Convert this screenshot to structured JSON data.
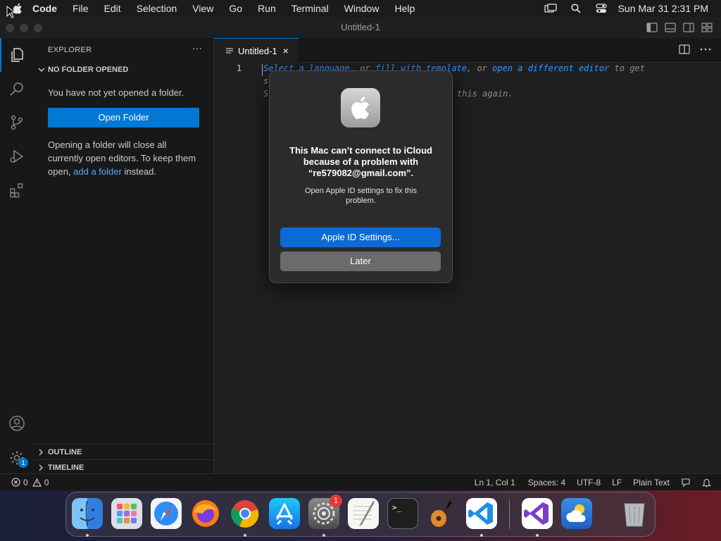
{
  "menubar": {
    "app": "Code",
    "items": [
      "File",
      "Edit",
      "Selection",
      "View",
      "Go",
      "Run",
      "Terminal",
      "Window",
      "Help"
    ],
    "clock": "Sun Mar 31  2:31 PM"
  },
  "window": {
    "title": "Untitled-1"
  },
  "sidebar": {
    "title": "EXPLORER",
    "more": "···",
    "section": "NO FOLDER OPENED",
    "no_folder_text": "You have not yet opened a folder.",
    "open_folder_label": "Open Folder",
    "info_part1": "Opening a folder will close all currently open editors. To keep them open,",
    "info_link": "add a folder",
    "info_part2": "instead.",
    "outline": "OUTLINE",
    "timeline": "TIMELINE",
    "settings_badge": "1"
  },
  "editor": {
    "tab_label": "Untitled-1",
    "tab_close": "×",
    "line_number": "1",
    "hint_pre": "Select a language",
    "hint_mid1": ", or ",
    "hint_link2": "fill with template",
    "hint_mid2": ", or ",
    "hint_link3": "open a different editor",
    "hint_post": " to get",
    "hint_line2": "s",
    "hint_line3_start": "S",
    "hint_line3_end": "this again."
  },
  "statusbar": {
    "errors": "0",
    "warnings": "0",
    "position": "Ln 1, Col 1",
    "spaces": "Spaces: 4",
    "encoding": "UTF-8",
    "eol": "LF",
    "language": "Plain Text"
  },
  "dialog": {
    "title": "This Mac can’t connect to iCloud because of a problem with “re579082@gmail.com”.",
    "body": "Open Apple ID settings to fix this problem.",
    "primary": "Apple ID Settings...",
    "secondary": "Later"
  },
  "dock": {
    "apps": [
      "finder-icon",
      "launchpad-icon",
      "safari-icon",
      "firefox-icon",
      "chrome-icon",
      "app-store-icon",
      "system-settings-icon",
      "textedit-icon",
      "terminal-icon",
      "garageband-icon",
      "vscode-icon",
      "visual-studio-icon",
      "weather-icon",
      "trash-icon"
    ],
    "settings_badge": "1",
    "terminal_prompt": ">_"
  },
  "colors": {
    "accent": "#0078d4",
    "link": "#4daafc",
    "dialog_primary": "#0a6ad6",
    "badge": "#e5373a"
  }
}
